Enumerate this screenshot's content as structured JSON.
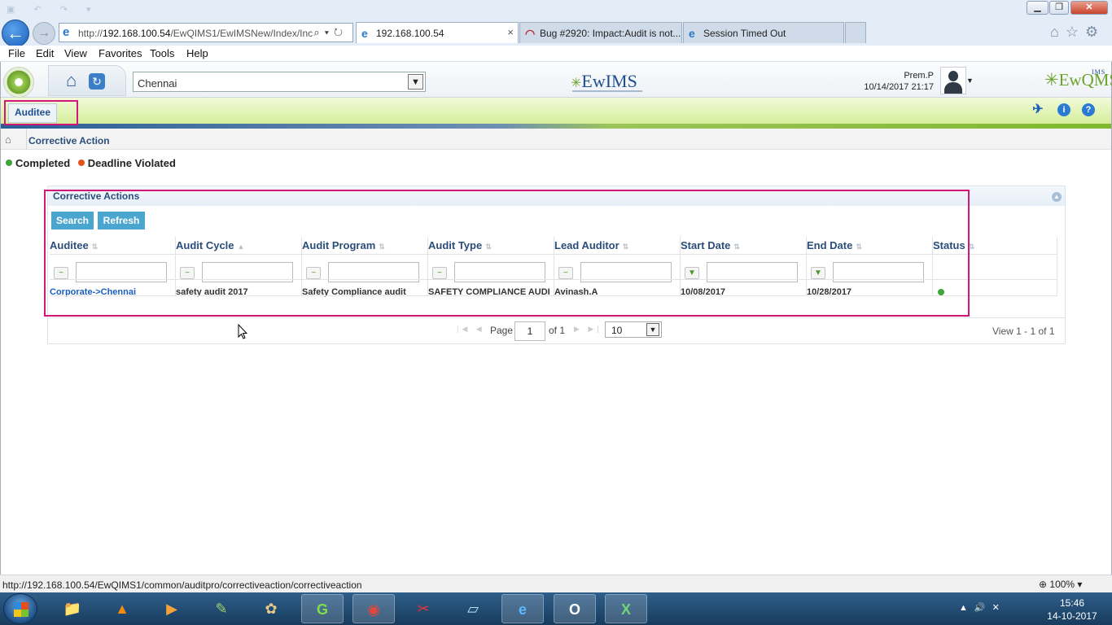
{
  "browser": {
    "address_url_prefix": "http://",
    "address_url_host": "192.168.100.54",
    "address_url_rest": "/EwQIMS1/EwIMSNew/Index/Inc",
    "tabs": [
      {
        "label": "192.168.100.54",
        "icon": "ie-icon",
        "active": true
      },
      {
        "label": "Bug #2920: Impact:Audit is not...",
        "icon": "bug-icon",
        "active": false
      },
      {
        "label": "Session Timed Out",
        "icon": "ie-icon",
        "active": false
      }
    ],
    "tab_close": "×",
    "menu": [
      "File",
      "Edit",
      "View",
      "Favorites",
      "Tools",
      "Help"
    ],
    "status_url": "http://192.168.100.54/EwQIMS1/common/auditpro/correctiveaction/correctiveaction",
    "zoom": "100%"
  },
  "app": {
    "location_select": "Chennai",
    "logo_center": "EwIMS",
    "logo_right": "EwQMS",
    "logo_right_sup": "IMS",
    "user_name": "Prem.P",
    "user_datetime": "10/14/2017 21:17",
    "role_tab": "Auditee",
    "breadcrumb": "Corrective Action",
    "legend": [
      {
        "label": "Completed",
        "color": "#3fa43a"
      },
      {
        "label": "Deadline Violated",
        "color": "#e5531c"
      }
    ],
    "panel": {
      "title": "Corrective Actions",
      "search_label": "Search",
      "refresh_label": "Refresh"
    },
    "grid": {
      "columns": [
        "Auditee",
        "Audit Cycle",
        "Audit Program",
        "Audit Type",
        "Lead Auditor",
        "Start Date",
        "End Date",
        "Status"
      ],
      "rows": [
        {
          "auditee": "Corporate->Chennai",
          "audit_cycle": "safety audit 2017",
          "audit_program": "Safety Compliance audit",
          "audit_type": "SAFETY COMPLIANCE AUDI",
          "lead_auditor": "Avinash.A",
          "start_date": "10/08/2017",
          "end_date": "10/28/2017",
          "status": "Completed"
        }
      ]
    },
    "pager": {
      "page_label": "Page",
      "page_value": "1",
      "of_label": "of 1",
      "page_size": "10",
      "view_text": "View 1 - 1 of 1"
    }
  },
  "taskbar": {
    "time": "15:46",
    "date": "14-10-2017",
    "apps": [
      "explorer",
      "vlc",
      "media-player",
      "notepad",
      "paint",
      "greenshot",
      "chrome",
      "snipping-tool",
      "editor",
      "internet-explorer",
      "outlook",
      "excel"
    ]
  }
}
